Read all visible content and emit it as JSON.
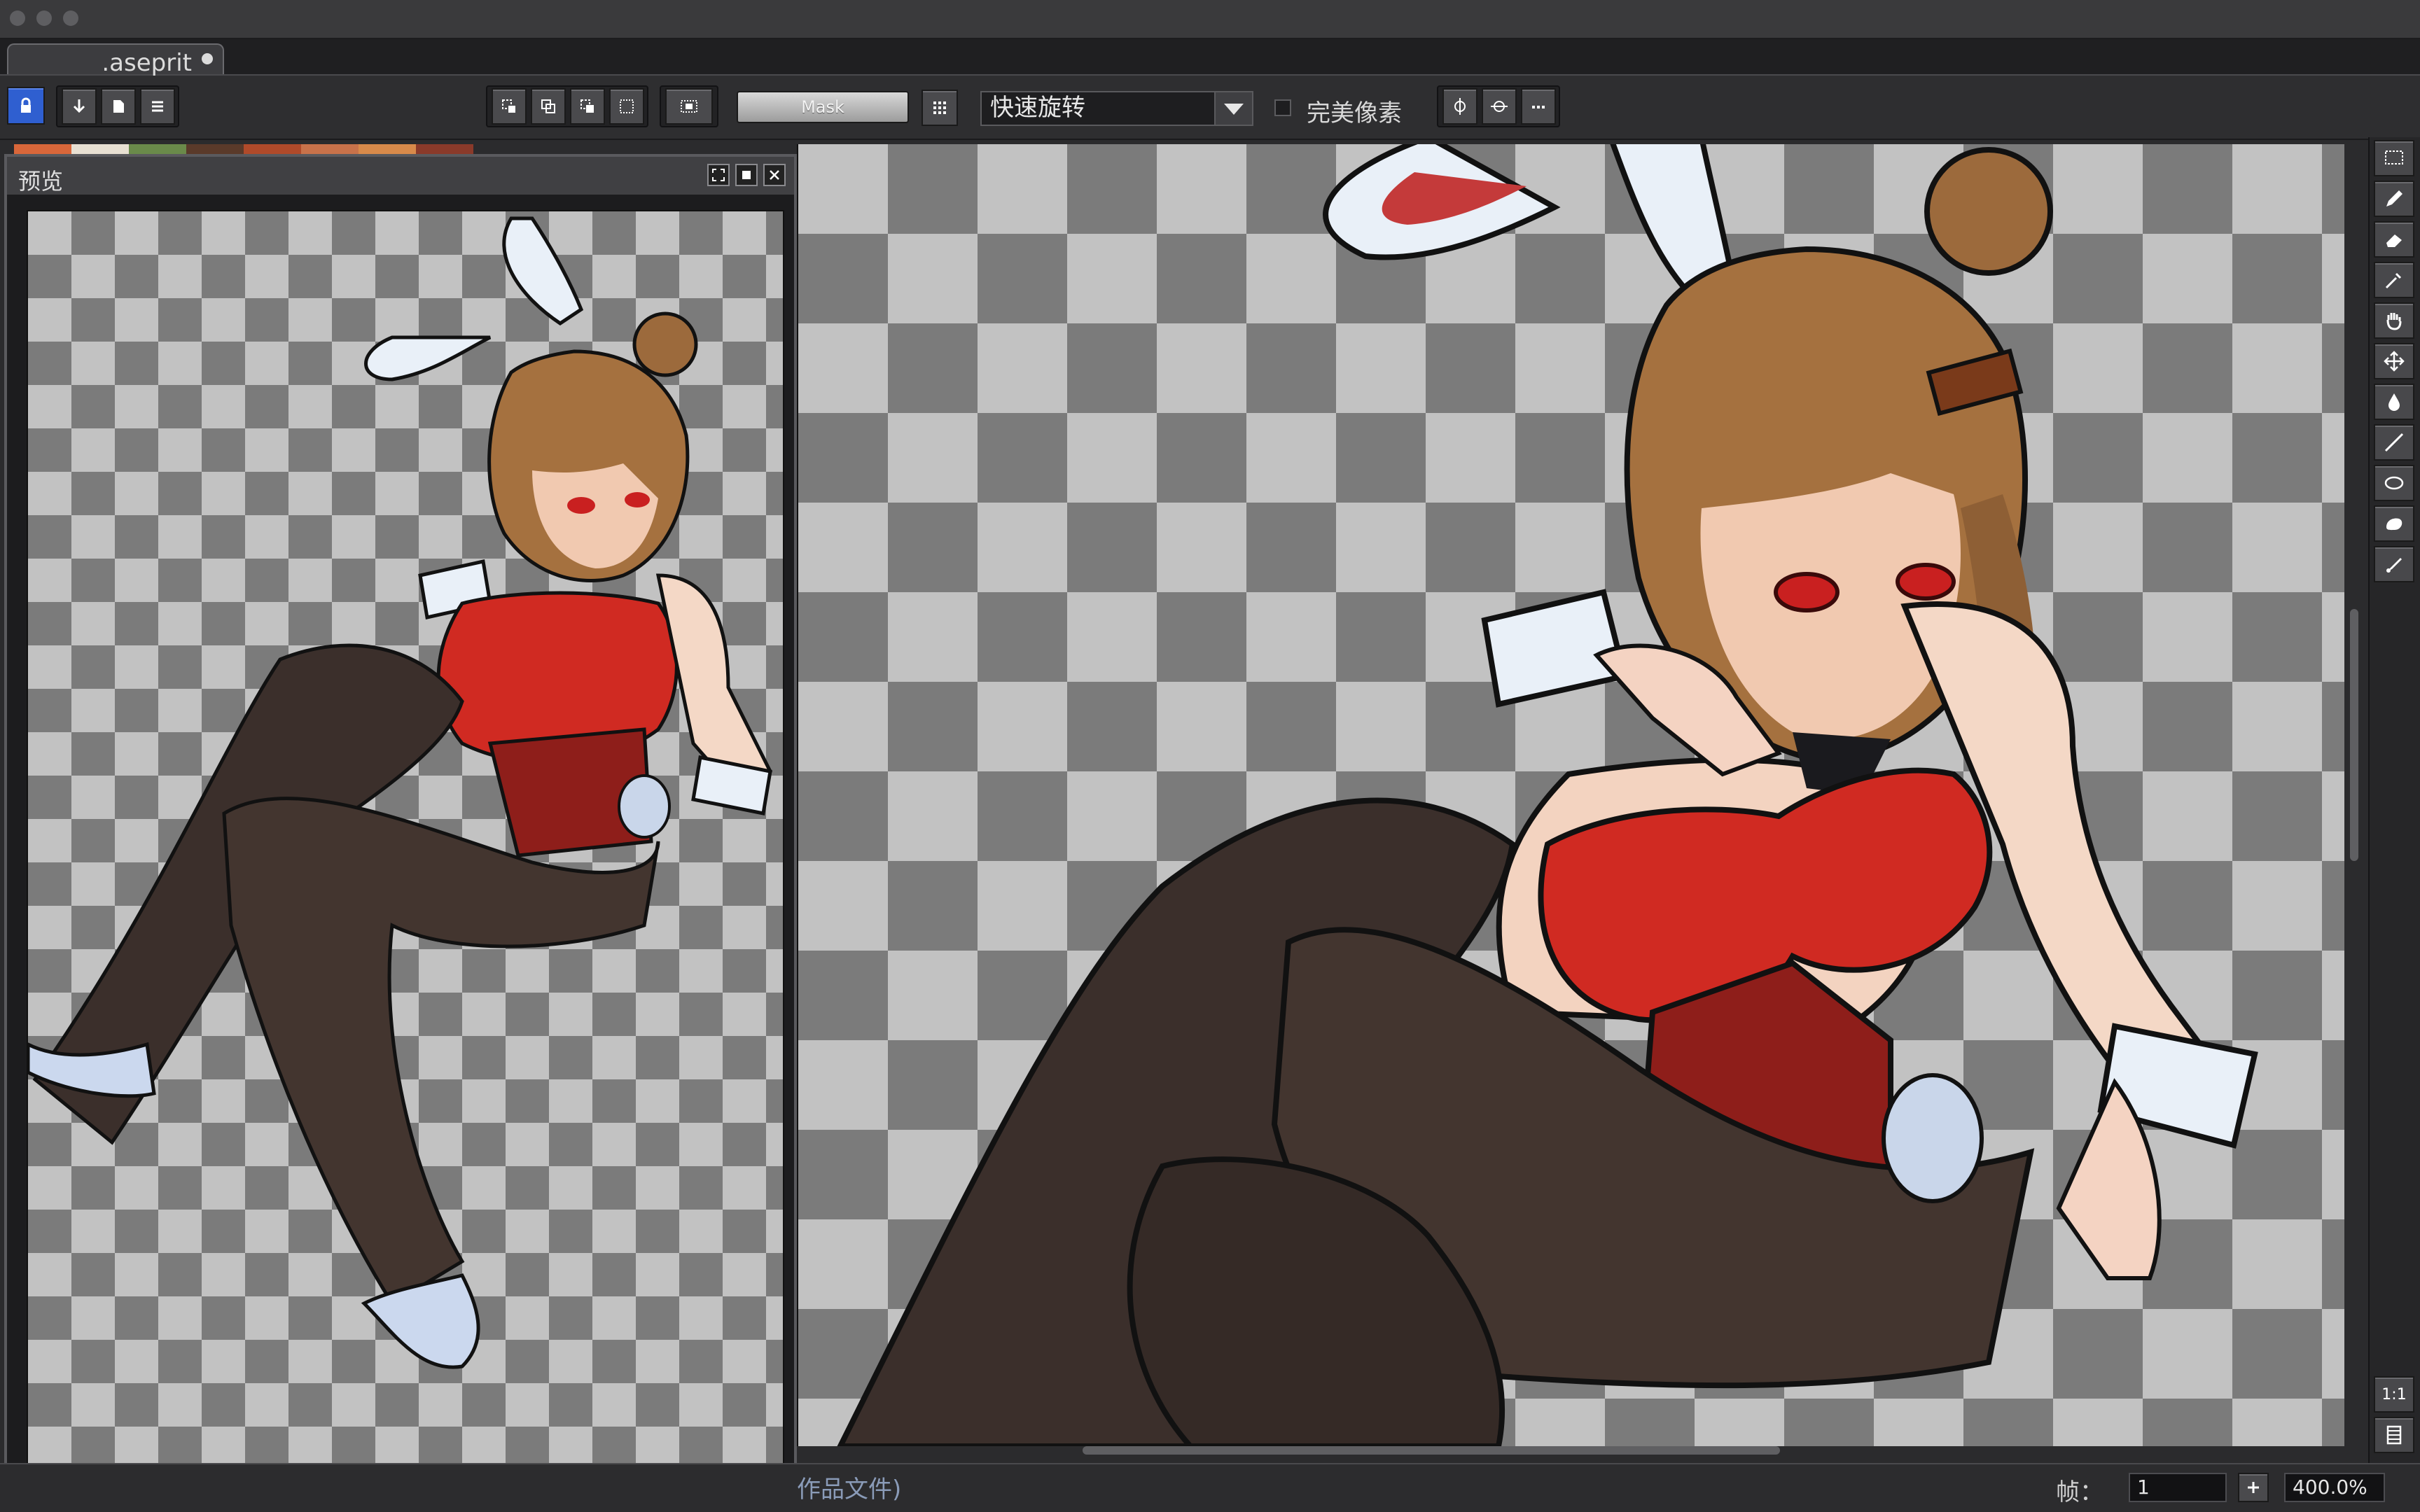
{
  "document": {
    "tab_name": ".aseprit"
  },
  "toolbar": {
    "mask_label": "Mask",
    "rotation_algorithm": "快速旋转",
    "pixel_perfect_label": "完美像素"
  },
  "preview": {
    "title": "预览"
  },
  "status": {
    "message": "作品文件)",
    "frame_label": "帧：",
    "frame_value": "1",
    "zoom_value": "400.0%"
  },
  "right_tools": {
    "zoom_1_1_label": "1:1"
  },
  "colors": {
    "accent": "#2f5fd0",
    "palette": [
      "#d9673a",
      "#e8e0d2",
      "#6a8a4a",
      "#5a3a2a",
      "#b04a2a",
      "#c8724a",
      "#d88a4a",
      "#8a3a2a"
    ]
  }
}
